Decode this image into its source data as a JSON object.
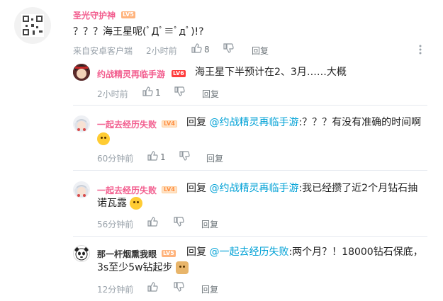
{
  "root": {
    "username": "圣光守护神",
    "level": "LV5",
    "content": "？？？海王星呢(ﾟДﾟ≡ﾟдﾟ)!?",
    "source": "来自安卓客户端",
    "time": "2小时前",
    "likes": "8",
    "reply_label": "回复"
  },
  "replies": [
    {
      "username": "约战精灵再临手游",
      "level": "LV6",
      "content": "海王星下半预计在2、3月……大概",
      "time": "2小时前",
      "likes": "1",
      "reply_label": "回复"
    },
    {
      "username": "一起去经历失败",
      "level": "LV4",
      "reply_prefix": "回复 ",
      "mention": "@约战精灵再临手游",
      "content": ":？？？有没有准确的时间啊",
      "time": "60分钟前",
      "likes": "1",
      "reply_label": "回复"
    },
    {
      "username": "一起去经历失败",
      "level": "LV4",
      "reply_prefix": "回复 ",
      "mention": "@约战精灵再临手游",
      "content_line1": ":我已经攒了近2个月钻石抽",
      "content_line2": "诺瓦露",
      "time": "56分钟前",
      "reply_label": "回复"
    },
    {
      "username": "那一杆烟熏我眼",
      "level": "LV5",
      "reply_prefix": "回复 ",
      "mention": "@一起去经历失败",
      "content_line1": ":两个月？！18000钻石保底，",
      "content_line2": "3s至少5w钻起步",
      "time": "12分钟前",
      "reply_label": "回复"
    }
  ]
}
